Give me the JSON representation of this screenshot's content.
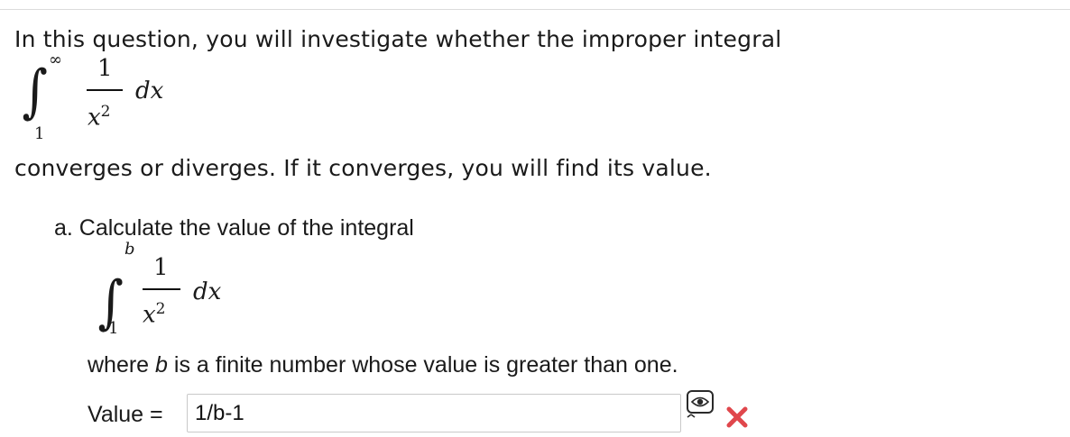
{
  "question": {
    "intro_line": "In this question, you will investigate whether the improper integral",
    "intro_line2": "converges or diverges. If it converges, you will find its value.",
    "main_integral": {
      "sign": "∫",
      "upper": "∞",
      "lower": "1",
      "numerator": "1",
      "denominator_var": "x",
      "denominator_exp": "2",
      "differential": "dx"
    }
  },
  "part_a": {
    "label": "a. Calculate the value of the integral",
    "integral": {
      "sign": "∫",
      "upper": "b",
      "lower": "1",
      "numerator": "1",
      "denominator_var": "x",
      "denominator_exp": "2",
      "differential": "dx"
    },
    "where_prefix": "where ",
    "where_var": "b",
    "where_suffix": " is a finite number whose value is greater than one.",
    "value_label": "Value = ",
    "value_input": "1/b-1",
    "answer_status": "incorrect"
  },
  "icons": {
    "preview": "preview-eye-icon",
    "status": "incorrect-x-icon"
  },
  "colors": {
    "incorrect": "#e0474c",
    "text": "#1a1a1a",
    "input_border": "#c9c9c9"
  }
}
